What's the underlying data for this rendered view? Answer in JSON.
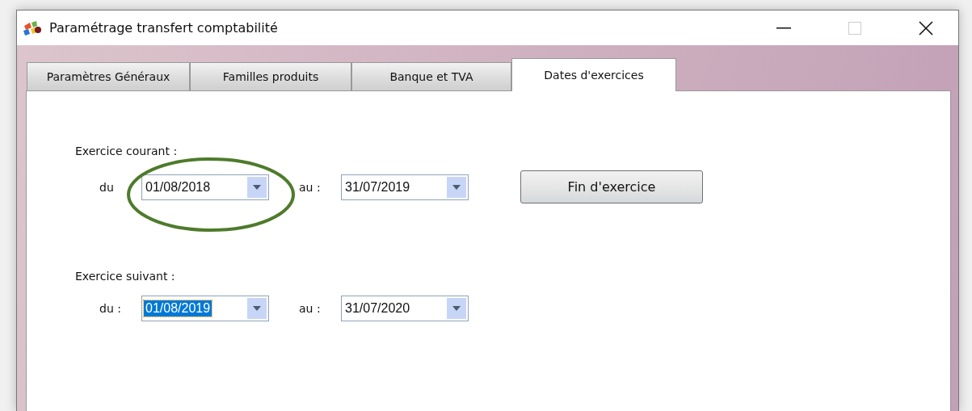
{
  "window": {
    "title": "Paramétrage transfert comptabilité"
  },
  "tabs": [
    {
      "label": "Paramètres Généraux",
      "selected": false
    },
    {
      "label": "Familles produits",
      "selected": false
    },
    {
      "label": "Banque et TVA",
      "selected": false
    },
    {
      "label": "Dates d'exercices",
      "selected": true
    }
  ],
  "sections": [
    {
      "label": "Exercice courant :",
      "from_label": "du",
      "from": {
        "value": "01/08/2018",
        "selected": false
      },
      "to_label": "au :",
      "to": {
        "value": "31/07/2019",
        "selected": false
      },
      "button": "Fin d'exercice",
      "annotation": {
        "kind": "ellipse"
      }
    },
    {
      "label": "Exercice suivant :",
      "from_label": "du :",
      "from": {
        "value": "01/08/2019",
        "selected": true
      },
      "to_label": "au :",
      "to": {
        "value": "31/07/2020",
        "selected": false
      }
    }
  ]
}
